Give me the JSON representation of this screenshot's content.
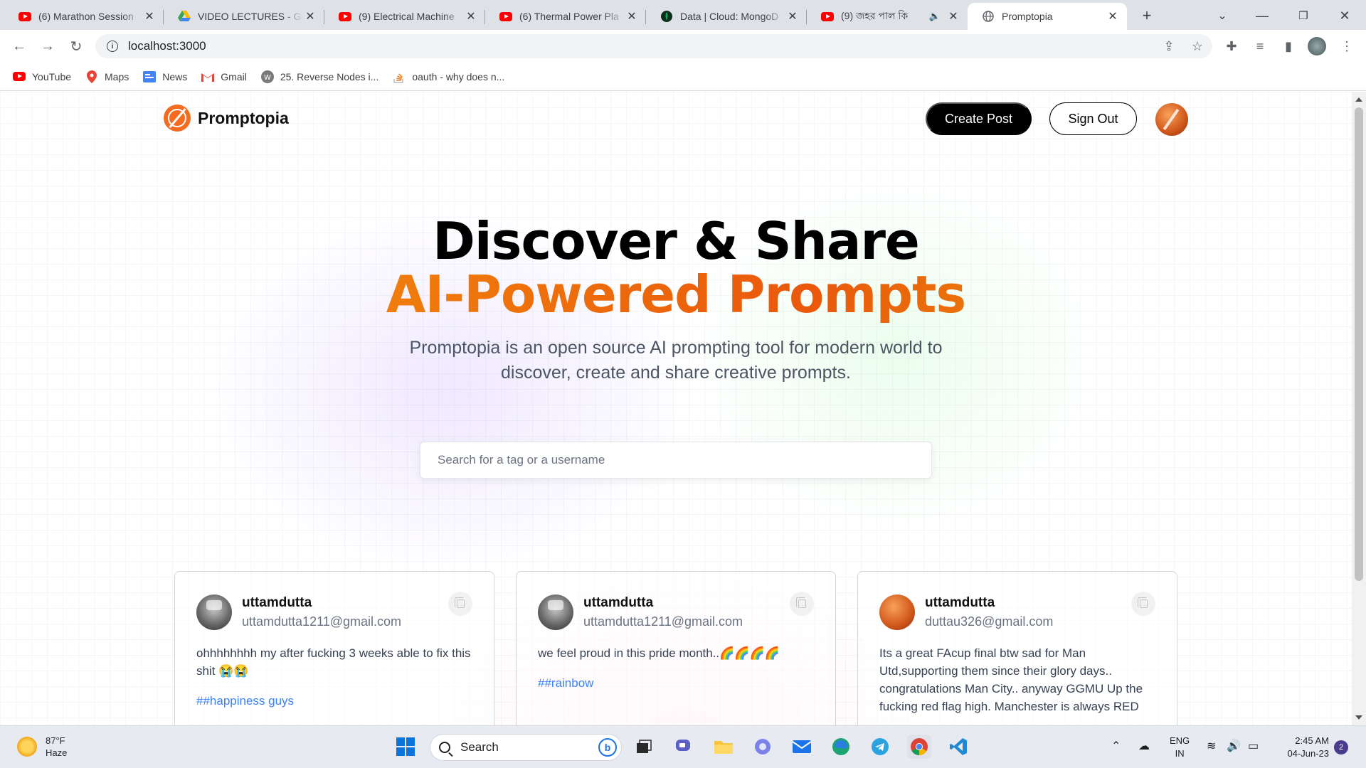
{
  "browser": {
    "tabs": [
      {
        "title": "(6) Marathon Session",
        "icon": "youtube-icon"
      },
      {
        "title": "VIDEO LECTURES - Go",
        "icon": "google-drive-icon"
      },
      {
        "title": "(9) Electrical Machine",
        "icon": "youtube-icon"
      },
      {
        "title": "(6) Thermal Power Pla",
        "icon": "youtube-icon"
      },
      {
        "title": "Data | Cloud: MongoD",
        "icon": "mongodb-icon"
      },
      {
        "title": "(9) জহর পাল কি",
        "icon": "youtube-icon"
      },
      {
        "title": "Promptopia",
        "icon": "globe-icon",
        "active": true
      }
    ],
    "url": "localhost:3000",
    "bookmarks": [
      {
        "label": "YouTube",
        "icon": "youtube-icon"
      },
      {
        "label": "Maps",
        "icon": "maps-pin-icon"
      },
      {
        "label": "News",
        "icon": "google-news-icon"
      },
      {
        "label": "Gmail",
        "icon": "gmail-icon"
      },
      {
        "label": "25. Reverse Nodes i...",
        "icon": "w-icon"
      },
      {
        "label": "oauth - why does n...",
        "icon": "stackoverflow-icon"
      }
    ]
  },
  "app": {
    "logo_text": "Promptopia",
    "nav": {
      "create_post": "Create Post",
      "sign_out": "Sign Out"
    },
    "hero": {
      "line1": "Discover & Share",
      "line2": "AI-Powered Prompts",
      "description": "Promptopia is an open source AI prompting tool for modern world to discover, create and share creative prompts."
    },
    "search_placeholder": "Search for a tag or a username",
    "posts": [
      {
        "username": "uttamdutta",
        "email": "uttamdutta1211@gmail.com",
        "text": "ohhhhhhhh my after fucking 3 weeks able to fix this shit 😭😭",
        "tag": "##happiness guys"
      },
      {
        "username": "uttamdutta",
        "email": "uttamdutta1211@gmail.com",
        "text": "we feel proud in this pride month..🌈🌈🌈🌈",
        "tag": "##rainbow"
      },
      {
        "username": "uttamdutta",
        "email": "duttau326@gmail.com",
        "text": "Its a great FAcup final btw sad for Man Utd,supporting them since their glory days.. congratulations Man City.. anyway GGMU Up the fucking red flag high. Manchester is always RED",
        "tag": ""
      }
    ]
  },
  "taskbar": {
    "weather_temp": "87°F",
    "weather_cond": "Haze",
    "search_label": "Search",
    "lang_top": "ENG",
    "lang_bottom": "IN",
    "time": "2:45 AM",
    "date": "04-Jun-23",
    "notification_count": "2"
  },
  "colors": {
    "accent_orange": "#ea580c",
    "tag_blue": "#3b82f6"
  }
}
